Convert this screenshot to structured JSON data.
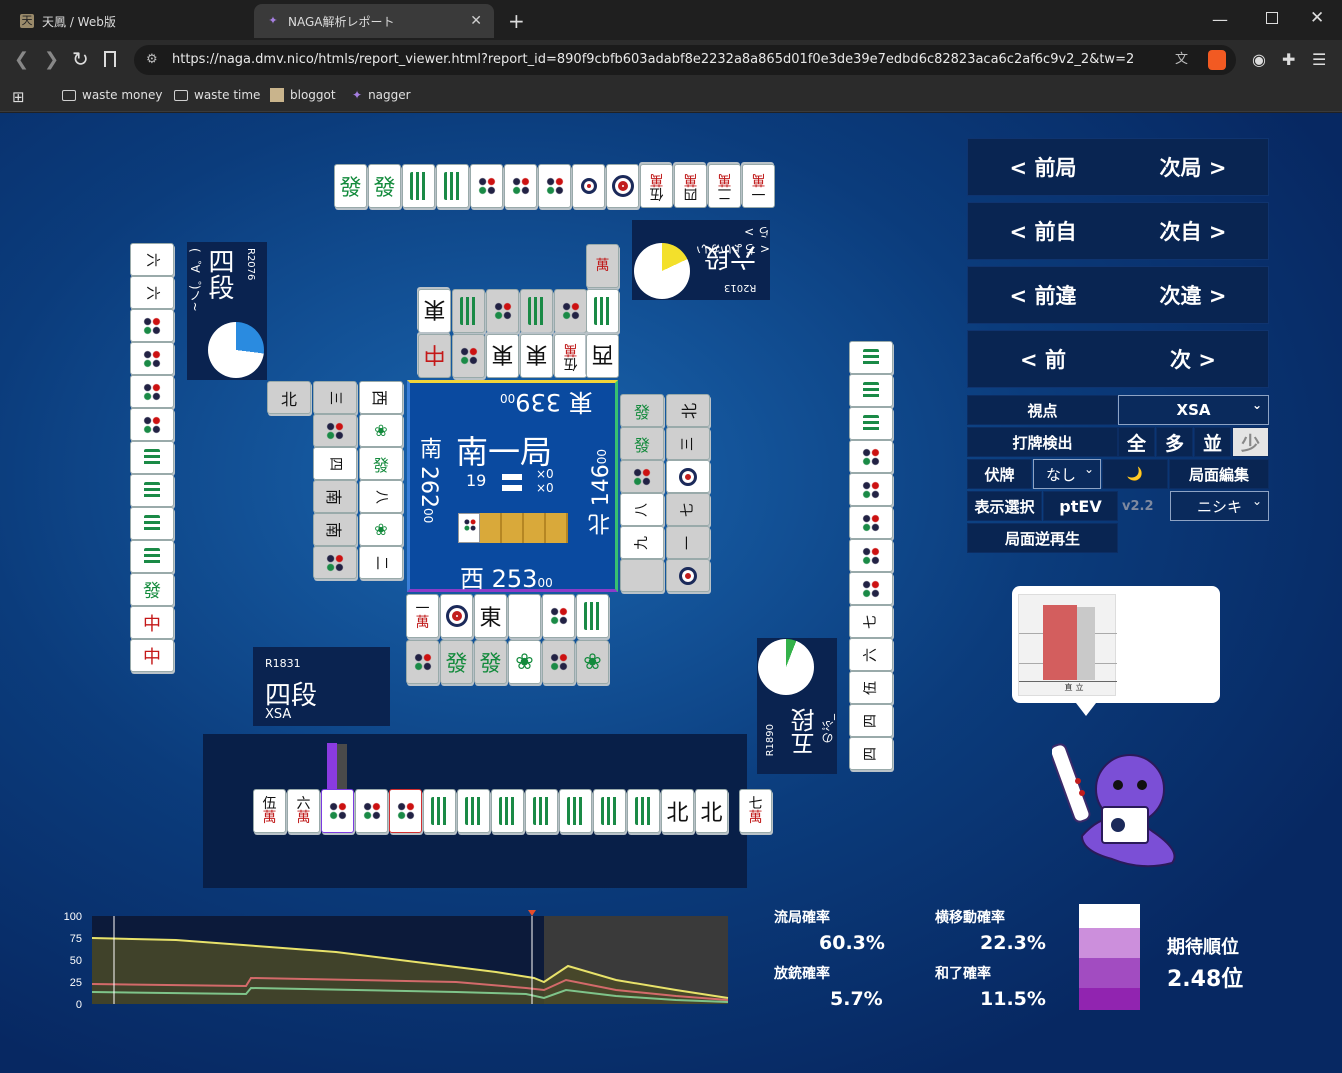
{
  "browser": {
    "tabs": [
      {
        "title": "天鳳 / Web版",
        "icon": "tenhou-icon"
      },
      {
        "title": "NAGA解析レポート",
        "icon": "naga-icon"
      }
    ],
    "new_tab": "+",
    "url": "https://naga.dmv.nico/htmls/report_viewer.html?report_id=890f9cbfb603adabf8e2232a8a865d01f0e3de39e7edbd6c82823aca6c2af6c9v2_2&tw=2",
    "bookmarks": [
      "waste money",
      "waste time",
      "bloggot",
      "nagger"
    ]
  },
  "center": {
    "round": "南一局",
    "honba": "19",
    "kyotaku": "×0",
    "riichi": "×0",
    "east": "東 339",
    "east_sub": "00",
    "south": "南 262",
    "south_sub": "00",
    "west": "西 253",
    "west_sub": "00",
    "north": "北 146",
    "north_sub": "00"
  },
  "players": {
    "top": {
      "rank": "六段",
      "rate": "R2013",
      "name": "< ちょいかいら >",
      "pie_fraction": 0.18
    },
    "left": {
      "rank": "四段",
      "rate": "R2076",
      "name": "(゜∀゜)ノ~",
      "pie_fraction": 0.27
    },
    "bottom": {
      "rank": "四段",
      "rate": "R1831",
      "name": "XSA"
    },
    "right": {
      "rank": "五段",
      "rate": "R1890",
      "name": "のぶ_",
      "pie_fraction": 0.06
    }
  },
  "nav": [
    {
      "prev": "< 前局",
      "next": "次局 >"
    },
    {
      "prev": "< 前自",
      "next": "次自 >"
    },
    {
      "prev": "< 前違",
      "next": "次違 >"
    },
    {
      "prev": "< 前",
      "next": "次 >"
    }
  ],
  "controls": {
    "viewpoint_label": "視点",
    "viewpoint_value": "XSA",
    "discard_detect_label": "打牌検出",
    "discard_detect_options": [
      "全",
      "多",
      "並",
      "少"
    ],
    "hide_label": "伏牌",
    "hide_value": "なし",
    "moon_icon": "🌙",
    "edit_label": "局面編集",
    "display_select_label": "表示選択",
    "ptev_label": "ptEV",
    "version": "v2.2",
    "model_value": "ニシキ",
    "reverse_play_label": "局面逆再生"
  },
  "bubble": {
    "bar_label": "立直"
  },
  "hand": {
    "tiles": [
      "伍萬",
      "六萬",
      "①",
      "⑥",
      "⑥",
      "1s",
      "4s",
      "4s",
      "7s",
      "7s",
      "8s",
      "8s",
      "北",
      "北"
    ],
    "draw": "七萬"
  },
  "graph": {
    "yticks": [
      "100",
      "75",
      "50",
      "25",
      "0"
    ],
    "colors": {
      "first": "#e8e26a",
      "second": "#d36a6a",
      "third": "#7fc48a"
    }
  },
  "stats": {
    "ryukyoku_label": "流局確率",
    "ryukyoku_value": "60.3%",
    "yoko_label": "横移動確率",
    "yoko_value": "22.3%",
    "houju_label": "放銃確率",
    "houju_value": "5.7%",
    "hora_label": "和了確率",
    "hora_value": "11.5%",
    "expected_rank_label": "期待順位",
    "expected_rank_value": "2.48位"
  }
}
